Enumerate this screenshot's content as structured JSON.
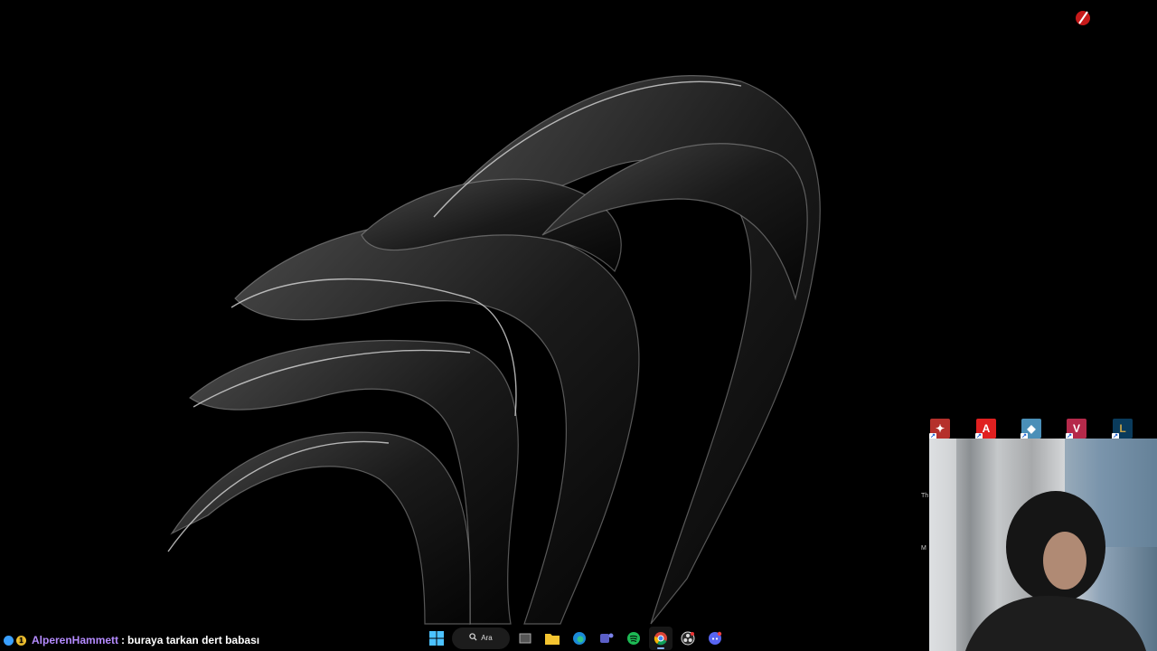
{
  "desktop": {
    "wallpaper": "dark abstract swirl wallpaper",
    "corner_logo_icon": "red-streamer-logo-icon",
    "icons": [
      {
        "name": "red-app-shortcut-icon",
        "color": "#c4302b"
      },
      {
        "name": "adobe-reader-shortcut-icon",
        "color": "#e02020"
      },
      {
        "name": "game-launcher-shortcut-icon",
        "color": "#4a8fb8"
      },
      {
        "name": "valorant-shortcut-icon",
        "color": "#b5294a"
      },
      {
        "name": "league-of-legends-shortcut-icon",
        "color": "#0a3b5c"
      }
    ],
    "cut_text_1": "Th",
    "cut_text_2": "M"
  },
  "chat": {
    "username": "AlperenHammett",
    "separator": " : ",
    "message": "buraya tarkan dert babası",
    "badge_colors": [
      "#3aa0ff",
      "#f2c230"
    ]
  },
  "taskbar": {
    "search_label": "Ara",
    "items": [
      {
        "name": "windows-start-icon"
      },
      {
        "name": "task-view-icon"
      },
      {
        "name": "file-explorer-icon"
      },
      {
        "name": "edge-browser-icon"
      },
      {
        "name": "teams-icon"
      },
      {
        "name": "spotify-icon"
      },
      {
        "name": "chrome-icon",
        "active": true
      },
      {
        "name": "obs-icon"
      },
      {
        "name": "discord-icon"
      }
    ]
  },
  "accent_colors": {
    "chat_user": "#b58bff",
    "taskbar_active": "#8ab4f8"
  }
}
